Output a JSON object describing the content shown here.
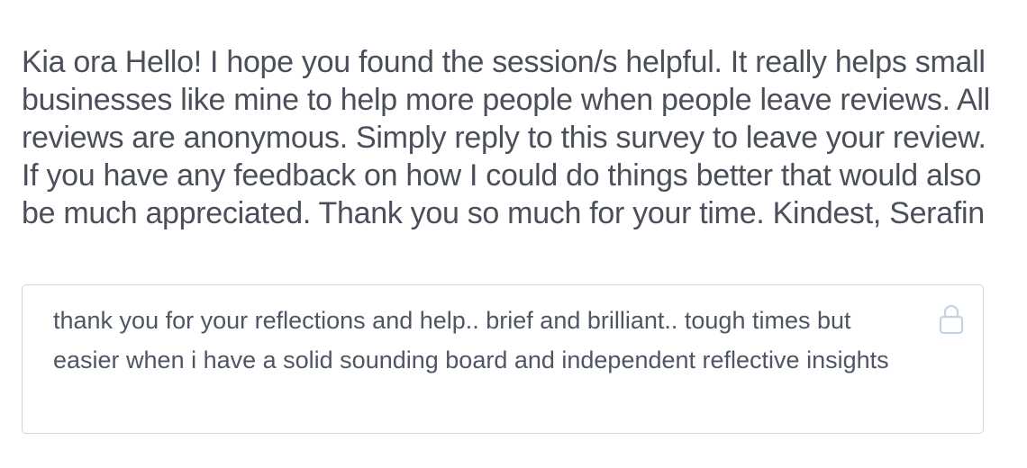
{
  "question": {
    "text": "Kia ora Hello! I hope you found the session/s helpful. It really helps small businesses like mine to help more people when people leave reviews. All reviews are anonymous. Simply reply to this survey to leave your review. If you have any feedback on how I could do things better that would also be much appreciated. Thank you so much for your time. Kindest, Serafin"
  },
  "answer": {
    "text": "thank you for your reflections and help.. brief and brilliant.. tough times but easier when i have a solid sounding board and independent reflective insights",
    "locked": true,
    "icon": "lock-icon"
  },
  "colors": {
    "text": "#4a4f5a",
    "answer_text": "#4f5663",
    "border": "#c7d6e6",
    "icon": "#c5d3e2"
  }
}
